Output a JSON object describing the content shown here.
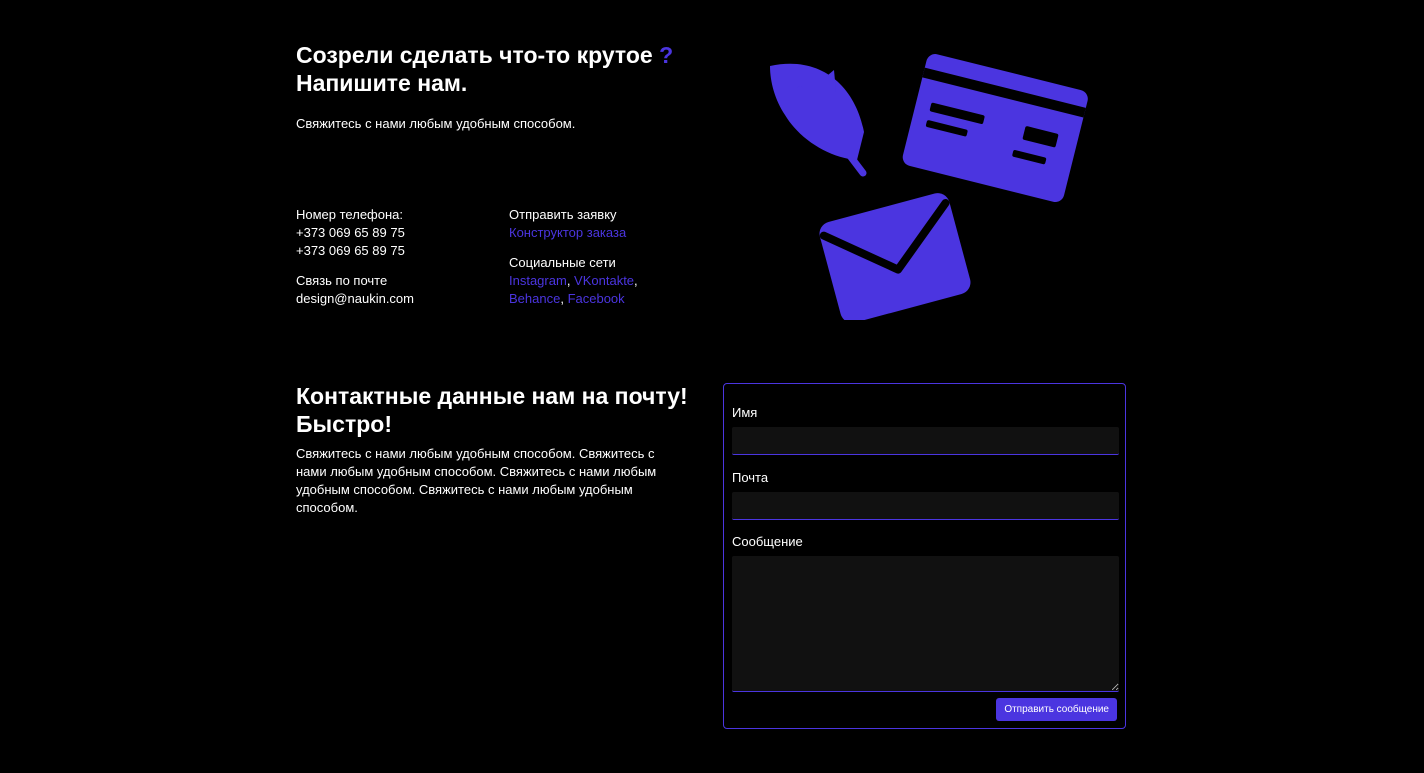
{
  "hero": {
    "title_part1": "Созрели сделать что-то крутое",
    "title_accent": "?",
    "title_part2": " Напишите нам.",
    "subtitle": "Свяжитесь с нами любым удобным способом."
  },
  "contacts": {
    "phone_label": "Номер телефона:",
    "phone_1": "+373 069 65 89 75",
    "phone_2": "+373 069 65 89 75",
    "email_label": "Связь по почте",
    "email": "design@naukin.com",
    "order_label": "Отправить заявку",
    "order_link": "Конструктор заказа",
    "social_label": "Социальные сети",
    "social": {
      "instagram": "Instagram",
      "vkontakte": "VKontakte",
      "behance": "Behance",
      "facebook": "Facebook"
    }
  },
  "illustration": {
    "icons": [
      "feather-icon",
      "credit-card-icon",
      "envelope-icon"
    ],
    "color": "#4b35e0"
  },
  "contact_section": {
    "title": "Контактные данные нам на почту! Быстро!",
    "text": "Свяжитесь с нами любым удобным способом. Свяжитесь с нами любым удобным способом. Свяжитесь с нами любым удобным способом. Свяжитесь с нами любым удобным способом."
  },
  "form": {
    "name_label": "Имя",
    "name_value": "",
    "email_label": "Почта",
    "email_value": "",
    "message_label": "Сообщение",
    "message_value": "",
    "submit_label": "Отправить сообщение"
  },
  "colors": {
    "background": "#000000",
    "accent": "#4b35e0",
    "input_bg": "#111111",
    "text": "#ffffff"
  }
}
